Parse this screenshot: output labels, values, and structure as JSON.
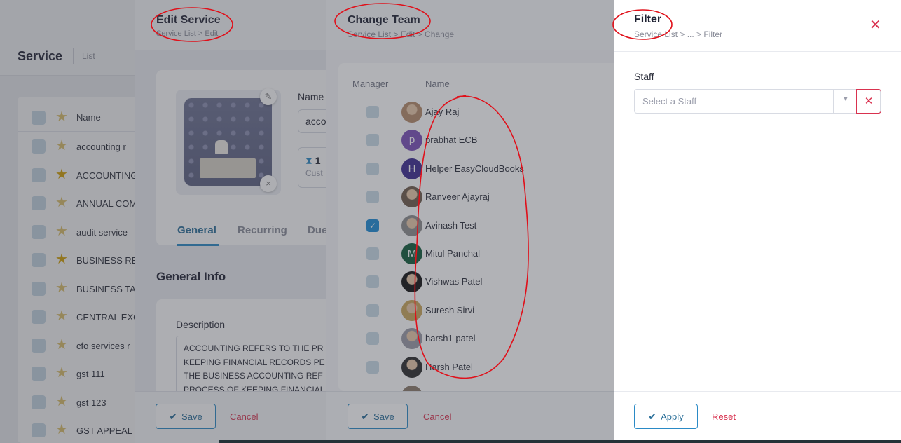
{
  "base": {
    "title": "Service",
    "subtitle": "List",
    "header_name": "Name",
    "rows": [
      {
        "label": "accounting r",
        "starred": false
      },
      {
        "label": "ACCOUNTING",
        "starred": true
      },
      {
        "label": "ANNUAL COM",
        "starred": false
      },
      {
        "label": "audit service",
        "starred": false
      },
      {
        "label": "BUSINESS RES",
        "starred": true
      },
      {
        "label": "BUSINESS TAX",
        "starred": false
      },
      {
        "label": "CENTRAL EXC",
        "starred": false
      },
      {
        "label": "cfo services r",
        "starred": false
      },
      {
        "label": "gst 111",
        "starred": false
      },
      {
        "label": "gst 123",
        "starred": false
      },
      {
        "label": "GST APPEAL",
        "starred": false
      }
    ]
  },
  "edit": {
    "title": "Edit Service",
    "breadcrumb": "Service List  >  Edit",
    "name_label": "Name",
    "name_value": "acco",
    "custom_value": "1",
    "custom_label": "Cust",
    "tabs": [
      "General",
      "Recurring",
      "Due"
    ],
    "section_title": "General Info",
    "description_label": "Description",
    "description_lines": [
      "ACCOUNTING REFERS TO THE PR",
      "KEEPING FINANCIAL RECORDS PE",
      "THE BUSINESS ACCOUNTING REF",
      "PROCESS OF KEEPING FINANCIAL"
    ],
    "save_label": "Save",
    "cancel_label": "Cancel"
  },
  "team": {
    "title": "Change Team",
    "breadcrumb": "Service List  >  Edit  >  Change",
    "col_manager": "Manager",
    "col_name": "Name",
    "members": [
      {
        "name": "Ajay Raj",
        "checked": false,
        "avatar": "photo",
        "initial": "",
        "color": "#b58a6a"
      },
      {
        "name": "prabhat ECB",
        "checked": false,
        "avatar": "initial",
        "initial": "p",
        "color": "#7a4fb8"
      },
      {
        "name": "Helper EasyCloudBooks",
        "checked": false,
        "avatar": "initial",
        "initial": "H",
        "color": "#3b2a8f"
      },
      {
        "name": "Ranveer Ajayraj",
        "checked": false,
        "avatar": "photo",
        "initial": "",
        "color": "#6e5a4a"
      },
      {
        "name": "Avinash Test",
        "checked": true,
        "avatar": "photo",
        "initial": "",
        "color": "#8c8c8c"
      },
      {
        "name": "Mitul Panchal",
        "checked": false,
        "avatar": "initial",
        "initial": "M",
        "color": "#0f5a3a"
      },
      {
        "name": "Vishwas Patel",
        "checked": false,
        "avatar": "photo",
        "initial": "",
        "color": "#111111"
      },
      {
        "name": "Suresh Sirvi",
        "checked": false,
        "avatar": "photo",
        "initial": "",
        "color": "#c9a65a"
      },
      {
        "name": "harsh1 patel",
        "checked": false,
        "avatar": "photo",
        "initial": "",
        "color": "#9a9aa6"
      },
      {
        "name": "Harsh Patel",
        "checked": false,
        "avatar": "photo",
        "initial": "",
        "color": "#2b2b2b"
      }
    ],
    "save_label": "Save",
    "cancel_label": "Cancel"
  },
  "filter": {
    "title": "Filter",
    "breadcrumb": "Service List  >  ...  >  Filter",
    "staff_label": "Staff",
    "staff_placeholder": "Select a Staff",
    "apply_label": "Apply",
    "reset_label": "Reset"
  },
  "colors": {
    "accent": "#2a8ac6",
    "danger": "#d9324f",
    "ink": "#e0101a"
  }
}
